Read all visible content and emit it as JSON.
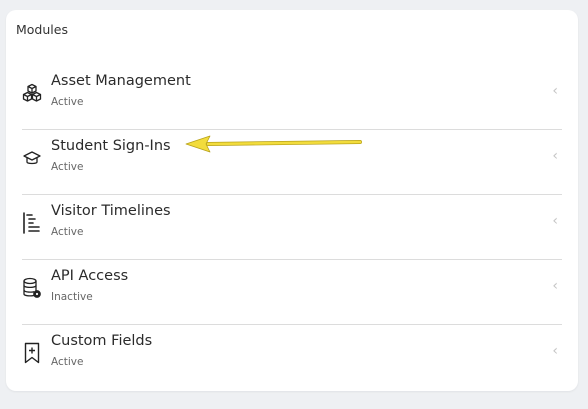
{
  "panel": {
    "title": "Modules",
    "items": [
      {
        "label": "Asset Management",
        "status": "Active",
        "icon": "cubes-icon"
      },
      {
        "label": "Student Sign-Ins",
        "status": "Active",
        "icon": "graduation-cap-icon"
      },
      {
        "label": "Visitor Timelines",
        "status": "Active",
        "icon": "timeline-list-icon"
      },
      {
        "label": "API Access",
        "status": "Inactive",
        "icon": "database-gear-icon"
      },
      {
        "label": "Custom Fields",
        "status": "Active",
        "icon": "bookmark-plus-icon"
      }
    ]
  },
  "annotation": {
    "arrow_color": "#f2dc3c"
  },
  "colors": {
    "chevron": "#c4c4c4",
    "divider": "#dcdcdc"
  }
}
